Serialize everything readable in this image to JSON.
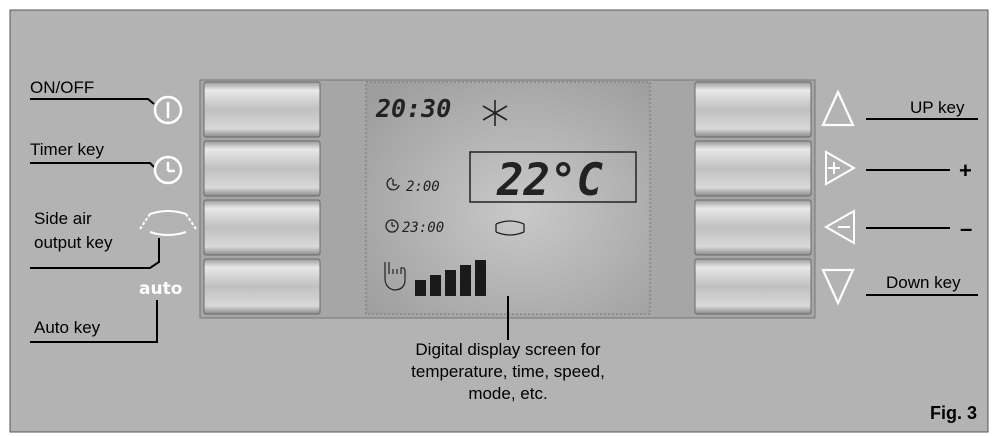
{
  "left_labels": {
    "on_off": "ON/OFF",
    "timer_key": "Timer key",
    "side_air_line1": "Side air",
    "side_air_line2": "output key",
    "auto_key": "Auto key",
    "auto_icon_text": "auto"
  },
  "right_labels": {
    "up_key": "UP key",
    "plus": "+",
    "minus": "–",
    "down_key": "Down key"
  },
  "display": {
    "clock": "20:30",
    "temperature": "22°C",
    "timer_on": "2:00",
    "timer_off": "23:00",
    "fan_speed_level": 5
  },
  "caption": {
    "line1": "Digital display screen for",
    "line2": "temperature, time, speed,",
    "line3": "mode, etc."
  },
  "figure_label": "Fig. 3",
  "colors": {
    "panel": "#b3b3b3",
    "display_bg": "#a9a9a9",
    "key_face": "#c2c2c2",
    "line": "#000000",
    "icon_white": "#ffffff"
  }
}
